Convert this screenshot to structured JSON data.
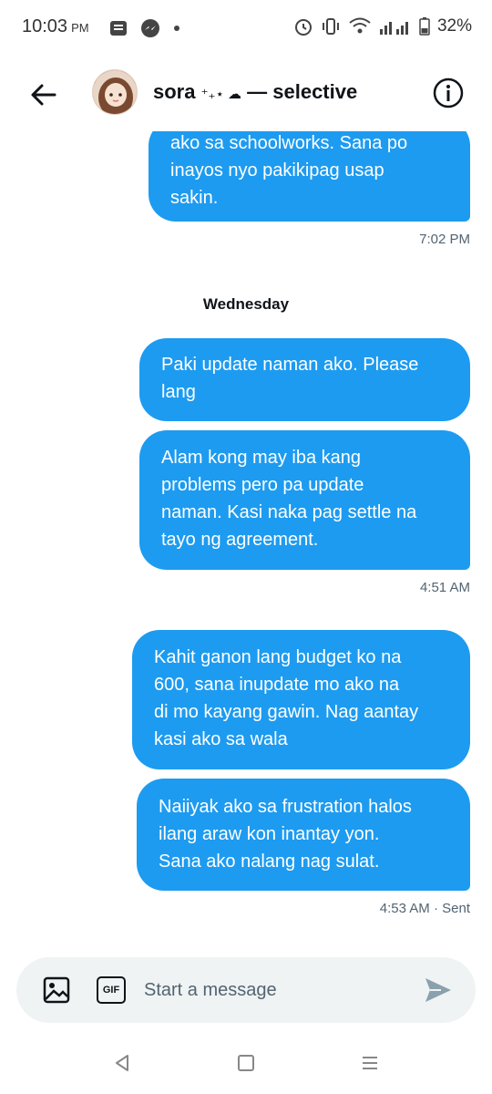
{
  "status_bar": {
    "time": "10:03",
    "ampm": "PM",
    "battery": "32%"
  },
  "header": {
    "name": "sora",
    "name_deco": "⁺₊⋆ ☁︎",
    "name_suffix": "— selective",
    "avatar_icon": "user-avatar",
    "back_icon": "arrow-left-icon",
    "info_icon": "info-icon"
  },
  "conversation": {
    "messages": [
      {
        "text": "ako sa schoolworks. Sana po inayos nyo pakikipag usap sakin.",
        "lines": [
          "ako sa schoolworks. Sana po",
          "inayos nyo pakikipag usap",
          "sakin."
        ]
      },
      {
        "text": "Paki update naman ako. Please lang",
        "lines": [
          "Paki update naman ako. Please",
          "lang"
        ]
      },
      {
        "text": "Alam kong may iba kang problems pero pa update naman. Kasi naka pag settle na tayo ng agreement.",
        "lines": [
          "Alam kong may iba kang",
          "problems pero pa update",
          "naman. Kasi naka pag settle na",
          "tayo ng agreement."
        ]
      },
      {
        "text": "Kahit ganon lang budget ko na 600, sana inupdate mo ako na di mo kayang gawin. Nag aantay kasi ako sa wala",
        "lines": [
          "Kahit ganon lang budget ko na",
          "600, sana inupdate mo ako na",
          "di mo kayang gawin. Nag aantay",
          "kasi ako sa wala"
        ]
      },
      {
        "text": "Naiiyak ako sa frustration halos ilang araw kon inantay yon. Sana ako nalang nag sulat.",
        "lines": [
          "Naiiyak ako sa frustration halos",
          "ilang araw kon inantay yon.",
          "Sana ako nalang nag sulat."
        ]
      }
    ],
    "timestamps": [
      "7:02 PM",
      "4:51 AM",
      "4:53 AM · Sent"
    ],
    "day_separator": "Wednesday"
  },
  "composer": {
    "placeholder": "Start a message",
    "gif_label": "GIF",
    "image_icon": "image-icon",
    "send_icon": "send-icon"
  },
  "colors": {
    "bubble": "#1d9bf0",
    "meta": "#536471",
    "composer_bg": "#eff3f4"
  }
}
